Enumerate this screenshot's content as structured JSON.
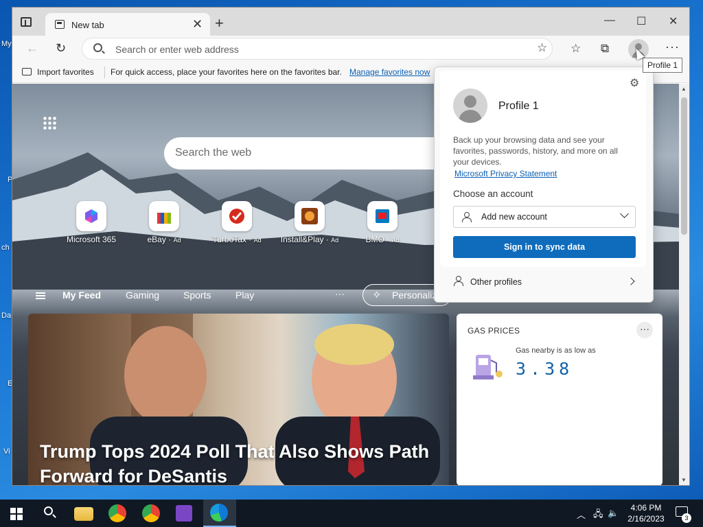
{
  "desktop": {
    "icons": [
      "My",
      "P",
      "ch",
      "Da",
      "E",
      "Vi"
    ]
  },
  "browser": {
    "tab": {
      "title": "New tab",
      "close": "✕"
    },
    "new_tab": "+",
    "window_controls": {
      "minimize": "—",
      "maximize": "☐",
      "close": "✕"
    },
    "address": {
      "placeholder": "Search or enter web address"
    },
    "favorites_bar": {
      "import_label": "Import favorites",
      "hint": "For quick access, place your favorites here on the favorites bar.",
      "manage_link": "Manage favorites now"
    },
    "tooltip": "Profile 1"
  },
  "newtab": {
    "search_placeholder": "Search the web",
    "tiles": [
      {
        "label": "Microsoft 365",
        "ad": ""
      },
      {
        "label": "eBay",
        "ad": "Ad"
      },
      {
        "label": "TurboTax",
        "ad": "Ad"
      },
      {
        "label": "Install&Play",
        "ad": "Ad"
      },
      {
        "label": "BMO",
        "ad": "Ad"
      }
    ],
    "feed_nav": {
      "items": [
        "My Feed",
        "Gaming",
        "Sports",
        "Play"
      ],
      "more": "···",
      "personalize": "Personaliz"
    },
    "headline": "Trump Tops 2024 Poll That Also Shows Path Forward for DeSantis",
    "gas": {
      "title": "GAS PRICES",
      "more": "···",
      "subtitle": "Gas nearby is as low as",
      "price": "3.38"
    }
  },
  "profile_popup": {
    "name": "Profile 1",
    "description": "Back up your browsing data and see your favorites, passwords, history, and more on all your devices.",
    "privacy_link": "Microsoft Privacy Statement",
    "choose_label": "Choose an account",
    "account_select": "Add new account",
    "sync_button": "Sign in to sync data",
    "other_profiles": "Other profiles"
  },
  "taskbar": {
    "time": "4:06 PM",
    "date": "2/16/2023",
    "notification_count": "3"
  }
}
